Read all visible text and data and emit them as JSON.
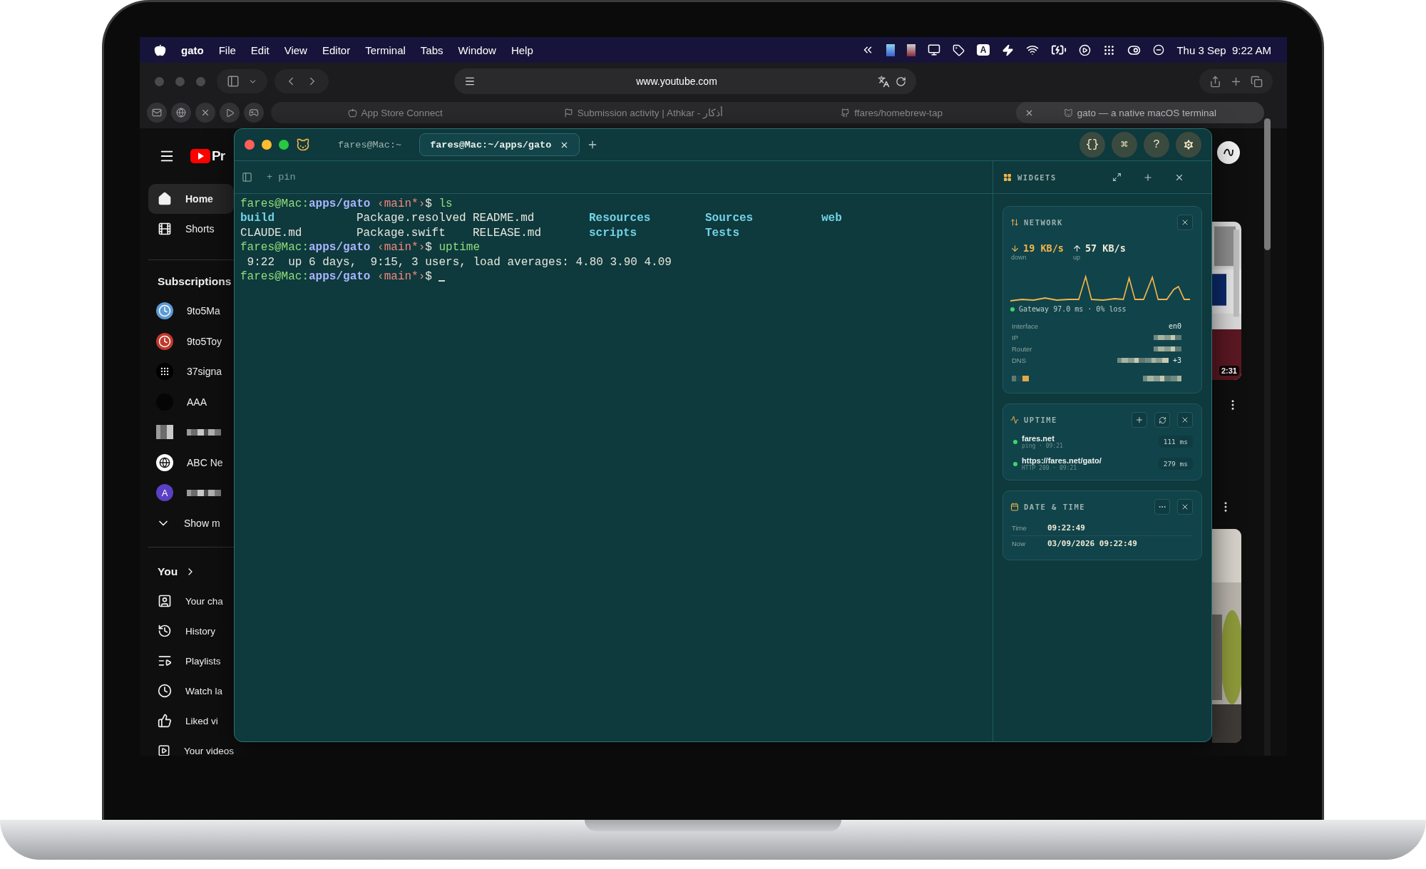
{
  "menubar": {
    "app": "gato",
    "menus": [
      "File",
      "Edit",
      "View",
      "Editor",
      "Terminal",
      "Tabs",
      "Window",
      "Help"
    ],
    "input_source": "A",
    "clock": "Thu 3 Sep  9:22 AM"
  },
  "browser": {
    "url": "www.youtube.com",
    "tabs": [
      {
        "title": "App Store Connect",
        "kind": "apple",
        "selected": false
      },
      {
        "title": "Submission activity | Athkar - أذكار",
        "kind": "flag",
        "selected": false
      },
      {
        "title": "ffares/homebrew-tap",
        "kind": "octocat",
        "selected": false
      },
      {
        "title": "gato — a native macOS terminal",
        "kind": "cat",
        "selected": true
      }
    ]
  },
  "youtube": {
    "logo_text": "Pr",
    "nav": [
      {
        "label": "Home",
        "kind": "home",
        "selected": true
      },
      {
        "label": "Shorts",
        "kind": "shorts",
        "selected": false
      }
    ],
    "subscriptions_title": "Subscriptions",
    "channels": [
      {
        "label": "9to5Ma",
        "kind": "clock",
        "color": "#5b9bd5",
        "redacted": false
      },
      {
        "label": "9to5Toy",
        "kind": "clock",
        "color": "#c0392b",
        "redacted": false
      },
      {
        "label": "37signa",
        "kind": "dots",
        "color": "#000000",
        "redacted": false
      },
      {
        "label": "AAA",
        "kind": "plain",
        "color": "#050505",
        "redacted": false
      },
      {
        "kind": "pixelated",
        "redacted": true
      },
      {
        "label": "ABC Ne",
        "kind": "news",
        "color": "#ffffff",
        "redacted": false
      },
      {
        "kind": "letter",
        "letter": "A",
        "color": "#5b3fc4",
        "redacted": true
      }
    ],
    "show_more": "Show m",
    "you_title": "You",
    "you_items": [
      {
        "label": "Your cha",
        "kind": "channel"
      },
      {
        "label": "History",
        "kind": "history"
      },
      {
        "label": "Playlists",
        "kind": "playlists"
      },
      {
        "label": "Watch la",
        "kind": "watch_later"
      },
      {
        "label": "Liked vi",
        "kind": "liked"
      },
      {
        "label": "Your videos",
        "kind": "videos"
      }
    ],
    "duration": "2:31"
  },
  "terminal": {
    "tabs": [
      {
        "title": "fares@Mac:~",
        "selected": false
      },
      {
        "title": "fares@Mac:~/apps/gato",
        "selected": true
      }
    ],
    "tools": [
      "{}",
      "⌘",
      "?"
    ],
    "pin": "+ pin",
    "lines": [
      {
        "kind": "prompt",
        "user": "fares@Mac:",
        "path": "apps/gato",
        "branch": " ‹main*›",
        "symbol": "$ ",
        "command": "ls",
        "cursor": false
      },
      {
        "kind": "listing",
        "entries": [
          {
            "name": "build",
            "kind": "dir"
          },
          {
            "name": "Package.resolved",
            "kind": "file"
          },
          {
            "name": "README.md",
            "kind": "file"
          },
          {
            "name": "Resources",
            "kind": "dir"
          },
          {
            "name": "Sources",
            "kind": "dir"
          },
          {
            "name": "web",
            "kind": "dir"
          },
          {
            "name": "CLAUDE.md",
            "kind": "file"
          },
          {
            "name": "Package.swift",
            "kind": "file"
          },
          {
            "name": "RELEASE.md",
            "kind": "file"
          },
          {
            "name": "scripts",
            "kind": "dir"
          },
          {
            "name": "Tests",
            "kind": "dir"
          }
        ]
      },
      {
        "kind": "prompt",
        "user": "fares@Mac:",
        "path": "apps/gato",
        "branch": " ‹main*›",
        "symbol": "$ ",
        "command": "uptime",
        "cursor": false
      },
      {
        "kind": "output",
        "text": " 9:22  up 6 days,  9:15, 3 users, load averages: 4.80 3.90 4.09"
      },
      {
        "kind": "prompt",
        "user": "fares@Mac:",
        "path": "apps/gato",
        "branch": " ‹main*›",
        "symbol": "$ ",
        "cursor": true
      }
    ]
  },
  "widgets": {
    "title": "WIDGETS",
    "network": {
      "title": "NETWORK",
      "down": "19 KB/s",
      "down_label": "down",
      "up": "57 KB/s",
      "up_label": "up",
      "gateway": "Gateway 97.0 ms · 0% loss",
      "rows": [
        {
          "label": "Interface",
          "value": "en0",
          "redacted": false
        },
        {
          "label": "IP",
          "redacted": true
        },
        {
          "label": "Router",
          "redacted": true
        },
        {
          "label": "DNS",
          "redacted": true,
          "extra": "+3"
        }
      ]
    },
    "uptime": {
      "title": "UPTIME",
      "targets": [
        {
          "name": "fares.net",
          "detail": "ping · 09:21",
          "latency": "111 ms",
          "color": "#3fd36b"
        },
        {
          "name": "https://fares.net/gato/",
          "detail": "HTTP 200 · 09:21",
          "latency": "279 ms",
          "color": "#3fd36b"
        }
      ]
    },
    "datetime": {
      "title": "DATE & TIME",
      "rows": [
        {
          "label": "Time",
          "value": "09:22:49"
        },
        {
          "label": "Now",
          "value": "03/09/2026 09:22:49"
        }
      ]
    }
  }
}
